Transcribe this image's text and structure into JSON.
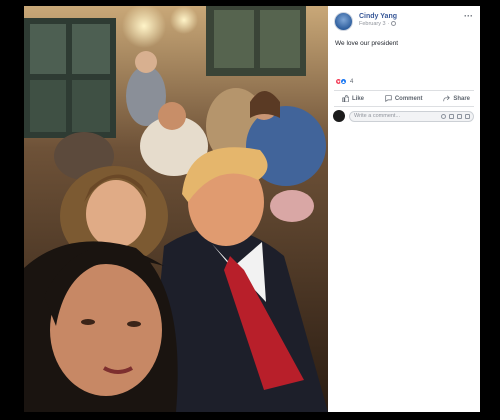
{
  "post": {
    "author": "Cindy Yang",
    "date": "February 3",
    "privacy_icon": "globe-icon",
    "text": "We love our president",
    "reaction_count": "4",
    "reaction_icons": [
      "love-icon",
      "like-icon"
    ]
  },
  "actions": {
    "like": "Like",
    "comment": "Comment",
    "share": "Share"
  },
  "comment_box": {
    "placeholder": "Write a comment..."
  },
  "colors": {
    "author_link": "#385898",
    "page_background": "#000000",
    "sidebar_background": "#ffffff"
  }
}
